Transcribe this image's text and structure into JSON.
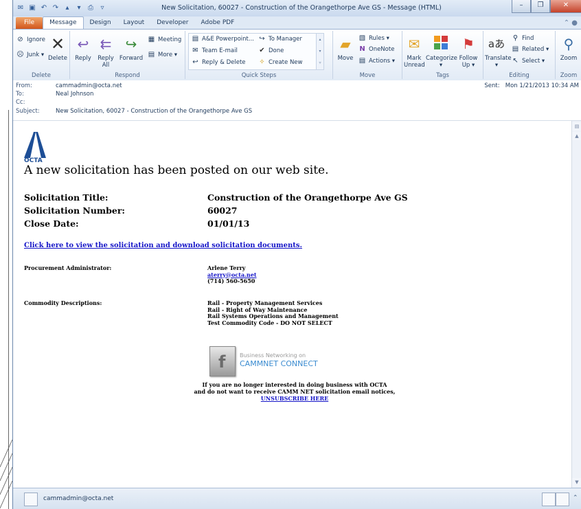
{
  "window": {
    "title": "New Solicitation, 60027 - Construction of the Orangethorpe Ave GS  -  Message (HTML)",
    "controls": [
      "–",
      "❐",
      "✕"
    ]
  },
  "ribbon_tabs": [
    "File",
    "Message",
    "Design",
    "Layout",
    "Developer",
    "Adobe PDF"
  ],
  "ribbon": {
    "delete_group": {
      "ignore": "Ignore",
      "junk": "Junk ▾",
      "delete": "Delete",
      "label": "Delete"
    },
    "respond_group": {
      "reply": "Reply",
      "reply_all_1": "Reply",
      "reply_all_2": "All",
      "forward": "Forward",
      "meeting": "Meeting",
      "more": "More ▾",
      "label": "Respond"
    },
    "quick_steps": {
      "ae": "A&E Powerpoint...",
      "team": "Team E-mail",
      "reply_delete": "Reply & Delete",
      "to_manager": "To Manager",
      "done": "Done",
      "create_new": "Create New",
      "label": "Quick Steps"
    },
    "move_group": {
      "move": "Move",
      "rules": "Rules ▾",
      "onenote": "OneNote",
      "actions": "Actions ▾",
      "label": "Move"
    },
    "tags_group": {
      "mark_unread_1": "Mark",
      "mark_unread_2": "Unread",
      "categorize_1": "Categorize",
      "categorize_2": "▾",
      "follow_1": "Follow",
      "follow_2": "Up ▾",
      "label": "Tags"
    },
    "editing_group": {
      "translate": "Translate",
      "translate_2": "▾",
      "find": "Find",
      "related": "Related ▾",
      "select": "Select ▾",
      "label": "Editing"
    },
    "zoom_group": {
      "zoom": "Zoom",
      "label": "Zoom"
    }
  },
  "header": {
    "from_label": "From:",
    "from": "cammadmin@octa.net",
    "to_label": "To:",
    "to": "Neal Johnson",
    "cc_label": "Cc:",
    "cc": "",
    "subject_label": "Subject:",
    "subject": "New Solicitation, 60027 - Construction of the Orangethorpe Ave GS",
    "sent_label": "Sent:",
    "sent": "Mon 1/21/2013 10:34 AM"
  },
  "message": {
    "logo_text": "OCTA",
    "headline": "A new solicitation has been posted on our web site.",
    "fields": [
      {
        "label": "Solicitation Title:",
        "value": "Construction of the Orangethorpe Ave GS"
      },
      {
        "label": "Solicitation Number:",
        "value": "60027"
      },
      {
        "label": "Close Date:",
        "value": "01/01/13"
      }
    ],
    "main_link": "Click here to view the solicitation and download solicitation documents.",
    "admin_label": "Procurement Administrator:",
    "admin_name": "Arlene Terry",
    "admin_email": "aterry@octa.net",
    "admin_phone": "(714) 560-5650",
    "commodity_label": "Commodity Descriptions:",
    "commodities": [
      "Rail - Property Management Services",
      "Rail - Right of Way Maintenance",
      "Rail Systems Operations and Management",
      "Test Commodity Code - DO NOT SELECT"
    ],
    "banner_line1": "Business Networking on",
    "banner_line2": "CAMMNET CONNECT",
    "unsub_line1": "If you are no longer interested in doing business with OCTA",
    "unsub_line2": "and do not want to receive CAMM NET solicitation email notices,",
    "unsub_link": "UNSUBSCRIBE HERE"
  },
  "people_pane": {
    "name": "cammadmin@octa.net"
  }
}
